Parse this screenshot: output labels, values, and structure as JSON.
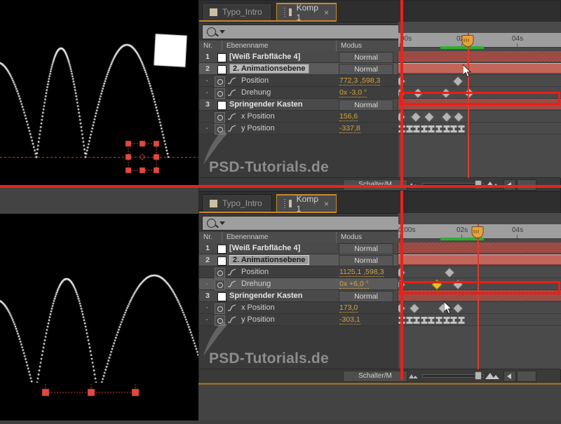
{
  "app": "Adobe After Effects Timeline",
  "watermark": "PSD-Tutorials.de",
  "panels": [
    {
      "id": "top",
      "tabs": [
        {
          "label": "Typo_Intro",
          "active": false,
          "closable": false
        },
        {
          "label": "Komp 1",
          "active": true,
          "closable": true,
          "close": "×"
        }
      ],
      "search_placeholder": "",
      "columns": {
        "nr": "Nr.",
        "name": "Ebenenname",
        "mode": "Modus"
      },
      "ruler_labels": [
        "00s",
        "02s",
        "04s"
      ],
      "current_time_seconds": 2.45,
      "rows": [
        {
          "kind": "layer",
          "num": "1",
          "name": "[Weiß Farbfläche 4]",
          "mode": "Normal",
          "selected": false,
          "highlight": false
        },
        {
          "kind": "layer",
          "num": "2",
          "name": "2. Animationsebene",
          "mode": "Normal",
          "selected": true,
          "highlight": true
        },
        {
          "kind": "prop",
          "name": "Position",
          "value": "772,3 ,598,3",
          "keys": [
            0,
            2.05
          ]
        },
        {
          "kind": "prop",
          "name": "Drehung",
          "value": "0x -3,0 °",
          "keys": [
            0,
            0.62,
            1.63,
            2.45
          ],
          "boxed": true
        },
        {
          "kind": "layer",
          "num": "3",
          "name": "Springender Kasten",
          "mode": "Normal",
          "selected": false,
          "highlight": false
        },
        {
          "kind": "prop",
          "name": "x Position",
          "value": "156,6",
          "keys": [
            0,
            0.55,
            1.02,
            1.64,
            2.08
          ]
        },
        {
          "kind": "prop",
          "name": "y Position",
          "value": "-337,8",
          "hold_keys": [
            0.05,
            0.32,
            0.58,
            0.85,
            1.11,
            1.38,
            1.64,
            1.91,
            2.17
          ]
        }
      ],
      "bottom": {
        "switches_label": "Schalter/M"
      }
    },
    {
      "id": "bottom",
      "tabs": [
        {
          "label": "Typo_Intro",
          "active": false,
          "closable": false
        },
        {
          "label": "Komp 1",
          "active": true,
          "closable": true,
          "close": "×"
        }
      ],
      "search_placeholder": "",
      "columns": {
        "nr": "Nr.",
        "name": "Ebenenname",
        "mode": "Modus"
      },
      "ruler_labels": [
        "0:00s",
        "02s",
        "04s"
      ],
      "current_time_seconds": 3.05,
      "rows": [
        {
          "kind": "layer",
          "num": "1",
          "name": "[Weiß Farbfläche 4]",
          "mode": "Normal",
          "selected": false,
          "highlight": false
        },
        {
          "kind": "layer",
          "num": "2",
          "name": "2. Animationsebene",
          "mode": "Normal",
          "selected": true,
          "highlight": true
        },
        {
          "kind": "prop",
          "name": "Position",
          "value": "1125,1 ,598,3",
          "keys": [
            0,
            1.75
          ]
        },
        {
          "kind": "prop",
          "name": "Drehung",
          "value": "0x +6,0 °",
          "keys": [
            0,
            1.3,
            2.05
          ],
          "gold_index": 1,
          "boxed": true
        },
        {
          "kind": "layer",
          "num": "3",
          "name": "Springender Kasten",
          "mode": "Normal",
          "selected": false,
          "highlight": false
        },
        {
          "kind": "prop",
          "name": "x Position",
          "value": "173,0",
          "keys": [
            0,
            0.5,
            1.52,
            2.05
          ]
        },
        {
          "kind": "prop",
          "name": "y Position",
          "value": "-303,1",
          "hold_keys": [
            0.05,
            0.32,
            0.58,
            0.85,
            1.11,
            1.38,
            1.64,
            1.91,
            2.17
          ]
        }
      ],
      "bottom": {
        "switches_label": "Schalter/M"
      }
    }
  ],
  "colors": {
    "accent_red": "#e8231b",
    "layer_bar": "#9a4740",
    "selected_bar": "#c4655c",
    "keyframe": "#b4b4b4",
    "keyframe_selected": "#e6c223",
    "value_text": "#d7a13c",
    "tab_active_border": "#c88a2e",
    "green_marker": "#2fae2f"
  },
  "viewer": {
    "motion_path_description": "dotted bouncing ball motion path",
    "white_square_label": "",
    "selection_handles": 8
  }
}
